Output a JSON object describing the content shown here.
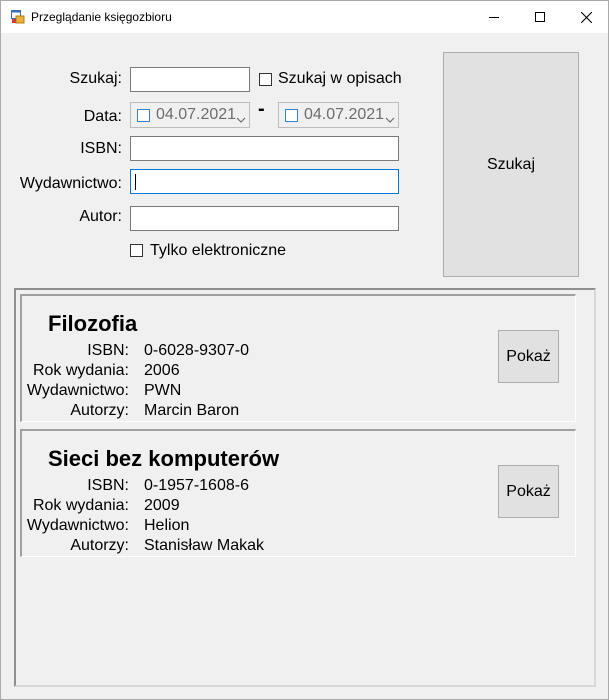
{
  "window": {
    "title": "Przeglądanie księgozbioru"
  },
  "search": {
    "label_search": "Szukaj:",
    "search_value": "",
    "search_in_desc_label": "Szukaj w opisach",
    "label_date": "Data:",
    "date_from": "04.07.2021",
    "date_separator": "-",
    "date_to": "04.07.2021",
    "label_isbn": "ISBN:",
    "isbn_value": "",
    "label_publisher": "Wydawnictwo:",
    "publisher_value": "",
    "label_author": "Autor:",
    "author_value": "",
    "ebooks_only_label": "Tylko elektroniczne",
    "search_button": "Szukaj"
  },
  "fields": {
    "isbn": "ISBN:",
    "year": "Rok wydania:",
    "publisher": "Wydawnictwo:",
    "authors": "Autorzy:"
  },
  "results": [
    {
      "title": "Filozofia",
      "isbn": "0-6028-9307-0",
      "year": "2006",
      "publisher": "PWN",
      "authors": "Marcin Baron",
      "button": "Pokaż"
    },
    {
      "title": "Sieci bez komputerów",
      "isbn": "0-1957-1608-6",
      "year": "2009",
      "publisher": "Helion",
      "authors": "Stanisław Makak",
      "button": "Pokaż"
    }
  ]
}
